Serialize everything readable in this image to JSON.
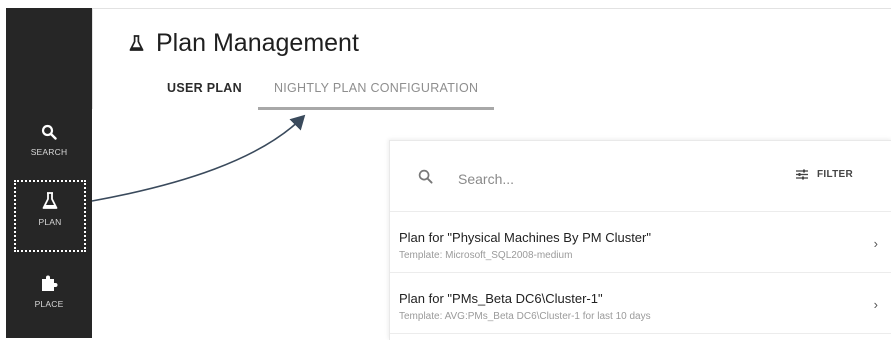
{
  "sidebar": {
    "items": [
      {
        "label": "SEARCH",
        "icon": "search-icon"
      },
      {
        "label": "PLAN",
        "icon": "flask-icon"
      },
      {
        "label": "PLACE",
        "icon": "puzzle-icon"
      }
    ]
  },
  "header": {
    "title": "Plan Management",
    "icon": "flask-icon",
    "tabs": [
      {
        "label": "USER PLAN",
        "active": true
      },
      {
        "label": "NIGHTLY PLAN CONFIGURATION",
        "active": false
      }
    ]
  },
  "panel": {
    "search": {
      "placeholder": "Search..."
    },
    "filter_label": "FILTER",
    "plans": [
      {
        "title": "Plan for \"Physical Machines By PM Cluster\"",
        "template": "Template: Microsoft_SQL2008-medium"
      },
      {
        "title": "Plan for \"PMs_Beta DC6\\Cluster-1\"",
        "template": "Template: AVG:PMs_Beta DC6\\Cluster-1 for last 10 days"
      }
    ]
  },
  "colors": {
    "sidebar_bg": "#262626",
    "tab_underline": "#a8a8a8",
    "arrow": "#3a4a5c"
  }
}
